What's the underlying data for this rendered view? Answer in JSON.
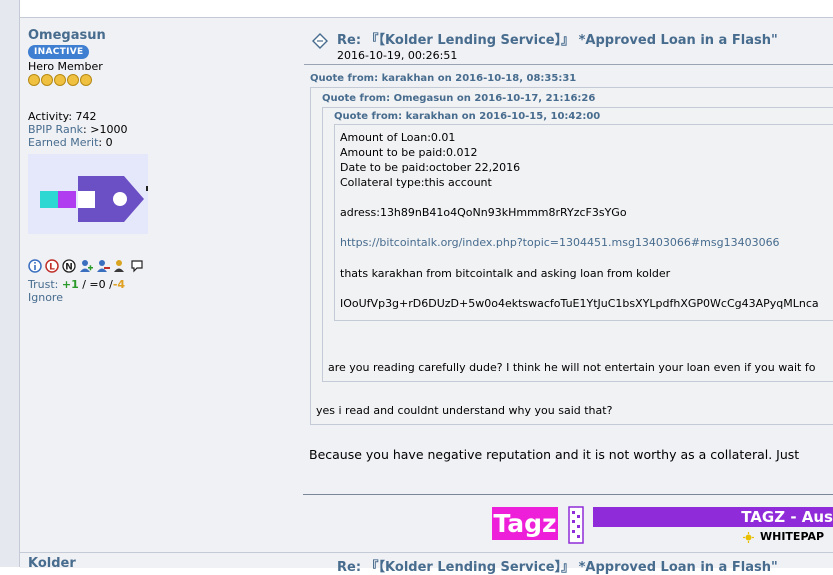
{
  "poster": {
    "name": "Omegasun",
    "status_badge": "INACTIVE",
    "rank": "Hero Member",
    "coins": 5,
    "activity_label": "Activity:",
    "activity_value": "742",
    "bpip_label": "BPIP Rank",
    "bpip_value": ": >1000",
    "merit_label": "Earned Merit",
    "merit_value": ": 0",
    "trust_label": "Trust:",
    "trust_pos": "+1",
    "trust_neutral": "/ =0 /",
    "trust_neg": "-4",
    "ignore_label": "Ignore"
  },
  "post": {
    "subject": "Re: 『【Kolder Lending Service】』 *Approved Loan in a Flash\"",
    "date": "2016-10-19, 00:26:51",
    "quote1_header": "Quote from: karakhan on 2016-10-18, 08:35:31",
    "quote2_header": "Quote from: Omegasun on 2016-10-17, 21:16:26",
    "quote3_header": "Quote from: karakhan on 2016-10-15, 10:42:00",
    "quote3_lines": {
      "l1": "Amount of Loan:0.01",
      "l2": "Amount to be paid:0.012",
      "l3": "Date to be paid:october 22,2016",
      "l4": "Collateral type:this account",
      "l5": "adress:13h89nB41o4QoNn93kHmmm8rRYzcF3sYGo",
      "l6": "https://bitcointalk.org/index.php?topic=1304451.msg13403066#msg13403066",
      "l7": "thats karakhan from bitcointalk and asking loan from kolder",
      "l8": "IOoUfVp3g+rD6DUzD+5w0o4ektswacfoTuE1YtJuC1bsXYLpdfhXGP0WcCg43APyqMLnca"
    },
    "quote2_reply": "are you reading carefully dude? I think he will not entertain your loan even if you wait fo",
    "quote1_reply": "yes i read and couldnt understand why you said that?",
    "body": "Because you have negative reputation and it is not worthy as a collateral. Just"
  },
  "signature": {
    "brand": "Tagz",
    "bar_text": "TAGZ - Aus",
    "whitepaper": "WHITEPAP"
  },
  "next_post": {
    "name": "Kolder",
    "subject": "Re: 『【Kolder Lending Service】』 *Approved Loan in a Flash\""
  },
  "colors": {
    "link": "#476c8e",
    "badge": "#3f7fd1",
    "sig_pink": "#ee1fd8",
    "sig_purple": "#8f2bd8"
  }
}
